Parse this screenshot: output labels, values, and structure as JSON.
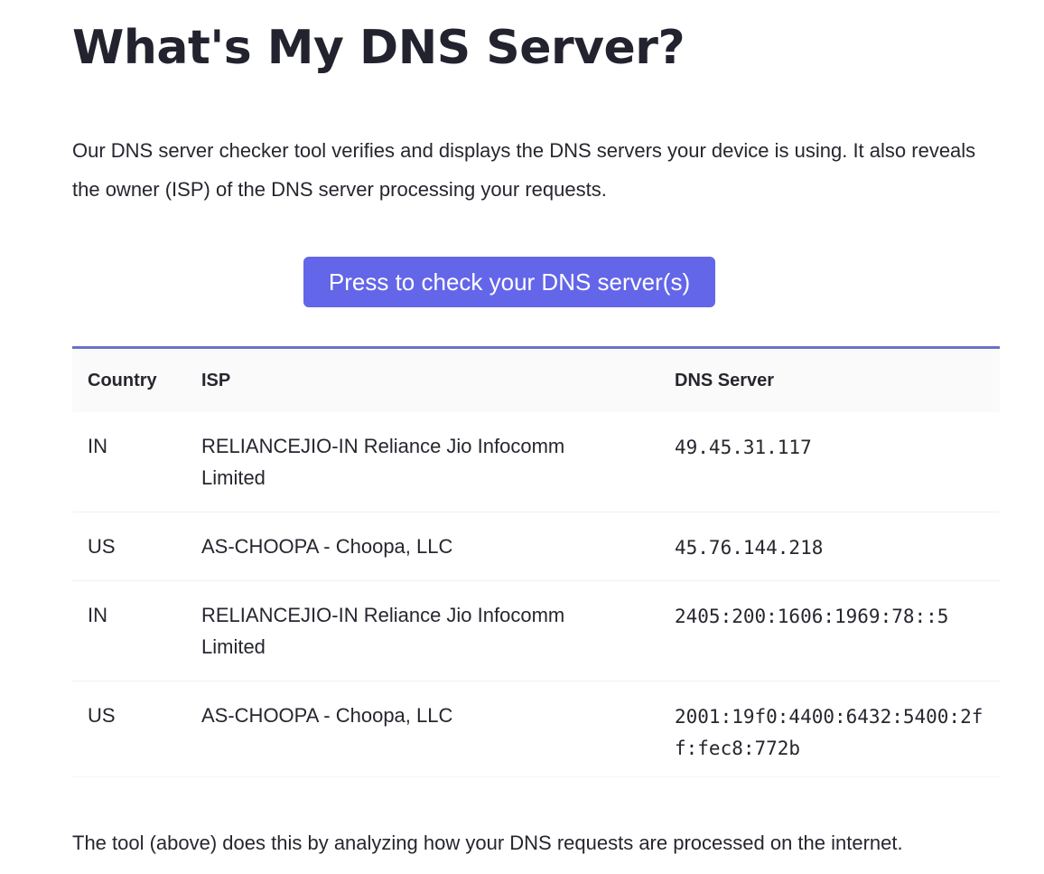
{
  "page": {
    "title": "What's My DNS Server?",
    "intro": "Our DNS server checker tool verifies and displays the DNS servers your device is using. It also reveals the owner (ISP) of the DNS server processing your requests.",
    "check_button_label": "Press to check your DNS server(s)",
    "footer_text": "The tool (above) does this by analyzing how your DNS requests are processed on the internet."
  },
  "table": {
    "headers": {
      "country": "Country",
      "isp": "ISP",
      "dns": "DNS Server"
    },
    "rows": [
      {
        "country": "IN",
        "isp": "RELIANCEJIO-IN Reliance Jio Infocomm Limited",
        "dns": "49.45.31.117"
      },
      {
        "country": "US",
        "isp": "AS-CHOOPA - Choopa, LLC",
        "dns": "45.76.144.218"
      },
      {
        "country": "IN",
        "isp": "RELIANCEJIO-IN Reliance Jio Infocomm Limited",
        "dns": "2405:200:1606:1969:78::5"
      },
      {
        "country": "US",
        "isp": "AS-CHOOPA - Choopa, LLC",
        "dns": "2001:19f0:4400:6432:5400:2ff:fec8:772b"
      }
    ]
  },
  "colors": {
    "accent": "#6366e8",
    "table_rule": "#6b70c9",
    "text": "#26262f"
  }
}
